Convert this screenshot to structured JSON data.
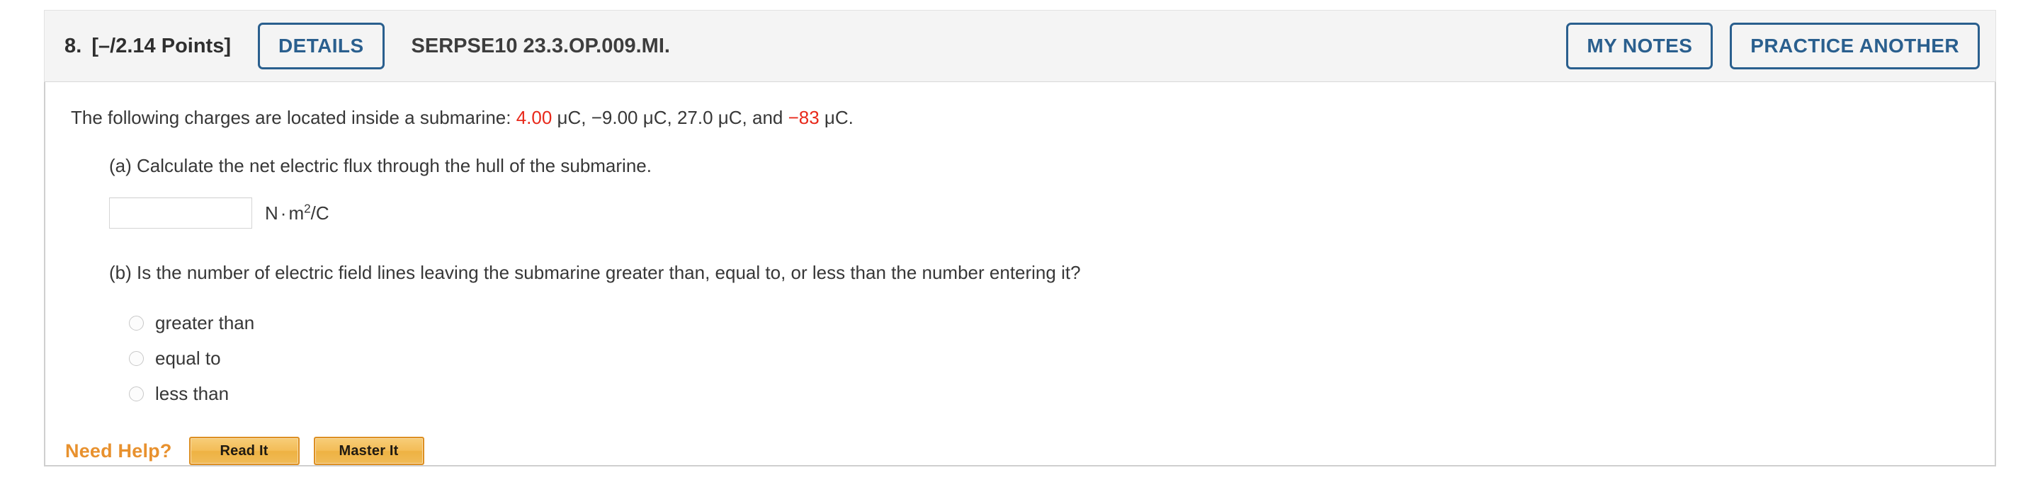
{
  "header": {
    "question_number": "8.",
    "points": "[–/2.14 Points]",
    "details_label": "DETAILS",
    "problem_code": "SERPSE10 23.3.OP.009.MI.",
    "my_notes_label": "MY NOTES",
    "practice_another_label": "PRACTICE ANOTHER"
  },
  "problem": {
    "stem_prefix": "The following charges are located inside a submarine: ",
    "charge_1": "4.00",
    "charge_1_unit": " μC, ",
    "charge_2": "−9.00 μC, ",
    "charge_3": "27.0 μC, and ",
    "charge_4": "−83",
    "charge_4_unit": " μC.",
    "part_a_text": "(a) Calculate the net electric flux through the hull of the submarine.",
    "part_a_input_value": "",
    "part_a_input_placeholder": "",
    "part_a_units_base": "N",
    "part_a_units_dot": "·",
    "part_a_units_m": "m",
    "part_a_units_exp": "2",
    "part_a_units_suffix": "/C",
    "part_b_text": "(b) Is the number of electric field lines leaving the submarine greater than, equal to, or less than the number entering it?",
    "choices": [
      {
        "label": "greater than",
        "selected": false
      },
      {
        "label": "equal to",
        "selected": false
      },
      {
        "label": "less than",
        "selected": false
      }
    ]
  },
  "need_help": {
    "label": "Need Help?",
    "read_it_label": "Read It",
    "master_it_label": "Master It"
  },
  "colors": {
    "accent_blue": "#2a5f8e",
    "highlight_red": "#e8291b",
    "need_help_orange": "#e8912e",
    "header_bg": "#f4f4f4",
    "panel_border": "#cfcfcf"
  }
}
